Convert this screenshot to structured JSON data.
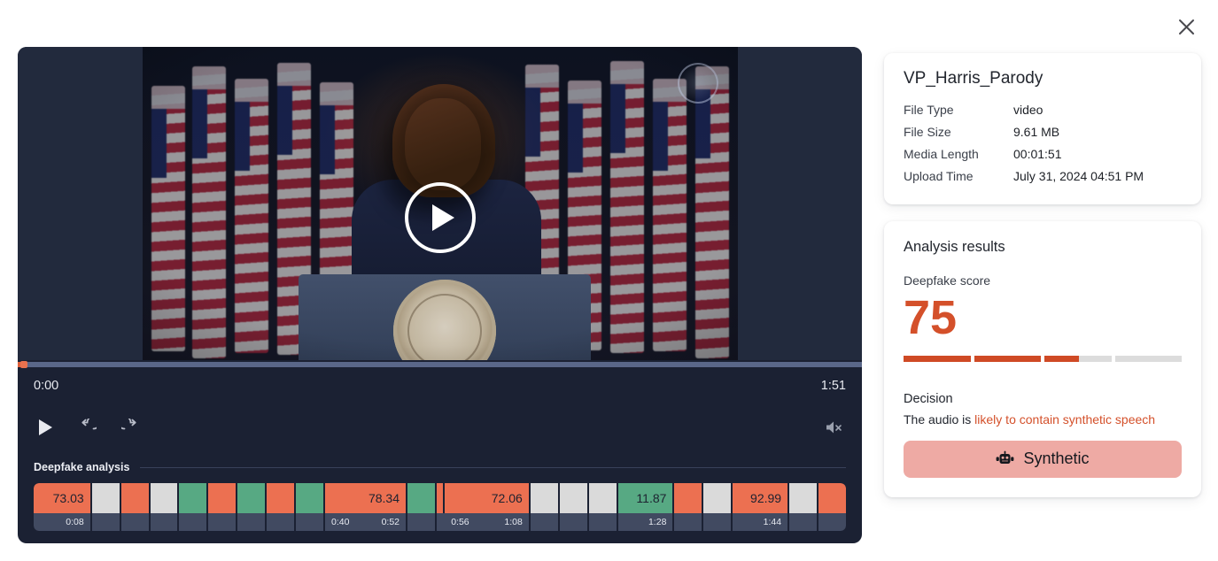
{
  "window": {
    "close_label": "close-icon"
  },
  "player": {
    "current_time": "0:00",
    "total_time": "1:51",
    "progress_percent": 0.6,
    "muted": true,
    "controls": {
      "play_label": "play-icon",
      "rewind_label": "rewind-icon",
      "forward_label": "forward-icon",
      "volume_label": "volume-muted-icon"
    },
    "overlay_play_label": "play-overlay-icon"
  },
  "timeline": {
    "section_label": "Deepfake analysis",
    "segments": [
      {
        "score": "73.03",
        "color": "#ec7051",
        "start": "",
        "end": "0:08",
        "flex": 70
      },
      {
        "score": "",
        "color": "#dadada",
        "start": "",
        "end": "",
        "flex": 34
      },
      {
        "score": "",
        "color": "#ec7051",
        "start": "",
        "end": "",
        "flex": 34
      },
      {
        "score": "",
        "color": "#dadada",
        "start": "",
        "end": "",
        "flex": 34
      },
      {
        "score": "",
        "color": "#57a983",
        "start": "",
        "end": "",
        "flex": 34
      },
      {
        "score": "",
        "color": "#ec7051",
        "start": "",
        "end": "",
        "flex": 34
      },
      {
        "score": "",
        "color": "#57a983",
        "start": "",
        "end": "",
        "flex": 34
      },
      {
        "score": "",
        "color": "#ec7051",
        "start": "",
        "end": "",
        "flex": 34
      },
      {
        "score": "",
        "color": "#57a983",
        "start": "",
        "end": "",
        "flex": 34
      },
      {
        "score": "78.34",
        "color": "#ec7051",
        "start": "0:40",
        "end": "0:52",
        "flex": 100
      },
      {
        "score": "",
        "color": "#57a983",
        "start": "",
        "end": "",
        "flex": 34
      },
      {
        "score": "",
        "color": "#ec7051",
        "start": "",
        "end": "",
        "flex": 8
      },
      {
        "score": "72.06",
        "color": "#ec7051",
        "start": "0:56",
        "end": "1:08",
        "flex": 104
      },
      {
        "score": "",
        "color": "#dadada",
        "start": "",
        "end": "",
        "flex": 34
      },
      {
        "score": "",
        "color": "#dadada",
        "start": "",
        "end": "",
        "flex": 34
      },
      {
        "score": "",
        "color": "#dadada",
        "start": "",
        "end": "",
        "flex": 34
      },
      {
        "score": "11.87",
        "color": "#57a983",
        "start": "",
        "end": "1:28",
        "flex": 68
      },
      {
        "score": "",
        "color": "#ec7051",
        "start": "",
        "end": "",
        "flex": 34
      },
      {
        "score": "",
        "color": "#dadada",
        "start": "",
        "end": "",
        "flex": 34
      },
      {
        "score": "92.99",
        "color": "#ec7051",
        "start": "",
        "end": "1:44",
        "flex": 68
      },
      {
        "score": "",
        "color": "#dadada",
        "start": "",
        "end": "",
        "flex": 34
      },
      {
        "score": "",
        "color": "#ec7051",
        "start": "",
        "end": "",
        "flex": 34
      }
    ]
  },
  "file_info": {
    "title": "VP_Harris_Parody",
    "rows": [
      {
        "key": "File Type",
        "value": "video"
      },
      {
        "key": "File Size",
        "value": "9.61 MB"
      },
      {
        "key": "Media Length",
        "value": "00:01:51"
      },
      {
        "key": "Upload Time",
        "value": "July 31, 2024 04:51 PM"
      }
    ]
  },
  "analysis": {
    "title": "Analysis results",
    "score_label": "Deepfake score",
    "score": "75",
    "score_bar": [
      100,
      100,
      52,
      0
    ],
    "accent_color": "#d4502a",
    "decision_label": "Decision",
    "decision_prefix": "The audio is ",
    "decision_highlight": "likely to contain synthetic speech",
    "verdict_label": "Synthetic",
    "verdict_icon": "robot-icon",
    "verdict_color": "#eeaaa4"
  }
}
